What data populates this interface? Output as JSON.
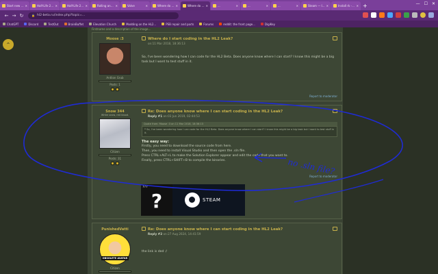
{
  "browser": {
    "tabs": [
      {
        "label": "Start new topic"
      },
      {
        "label": "Half-Life 2 Beta..."
      },
      {
        "label": "Half-Life 2 Beta..."
      },
      {
        "label": "Rolling animation"
      },
      {
        "label": "Valve"
      },
      {
        "label": "Where do I start co..."
      },
      {
        "label": "Where do I start codi...",
        "active": true
      },
      {
        "label": "..."
      },
      {
        "label": "..."
      },
      {
        "label": "..."
      },
      {
        "label": "Steam — Install"
      },
      {
        "label": "Install rk - Beyond Reh..."
      }
    ],
    "address": "hl2-beta.ru/index.php?topic=...",
    "bookmarks": [
      "ChatGPT",
      "Discord",
      "TestOut",
      "BrainBuffet",
      "Elevation Church",
      "Modding on the HL2...",
      "PSB repair and parts",
      "Forums",
      "reddit: the front page...",
      "DigiKey"
    ]
  },
  "page": {
    "top_strip": "Firstname and a description of the image...",
    "report_label": "Report to moderator"
  },
  "posts": [
    {
      "author": "Moose :3",
      "rank": "Antlion Grub",
      "posts_label": "Posts: 1",
      "title": "Where do I start coding in the HL2 Leak?",
      "meta_prefix": "on:",
      "meta_date": "11 Mar 2018, 18:36:13",
      "text": "So, I've been wondering how I can code for the HL2 Beta. Does anyone know where I can start? I know this might be a big task but I want to test stuff in it."
    },
    {
      "author": "Snow 344",
      "tagline": "White snow, red blood.",
      "rank": "Citizen",
      "posts_label": "Posts: 31",
      "title": "Re: Does anyone know where I can start coding in the HL2 Leak?",
      "meta_reply": "Reply #1",
      "meta_prefix": "on:",
      "meta_date": "03 Jun 2019, 02:44:53",
      "quote_head": "Quote from: Moose :3 on 11 Mar 2018, 18:36:13",
      "quote_text": "So, I've been wondering how I can code for the HL2 Beta. Does anyone know where I can start? I know this might be a big task but I want to test stuff in it.",
      "easy_way": "The easy way:",
      "lines": [
        "Firstly, you need to download the source code from here.",
        "Then, you need to install Visual Studio and then open the .sln file.",
        "Press CTRL+ALT+L to make the Solution Explorer appear and edit the code that you want to.",
        "Finally, press CTRL+SHIFT+B to compile the binaries."
      ],
      "signature": {
        "q_label": "???",
        "q_big": "?",
        "steam_label": "STEAM"
      }
    },
    {
      "author": "PunishedVatti",
      "rank": "Citizen",
      "avatar_caption": "OBSOLETE AVATAR",
      "title": "Re: Does anyone know where I can start coding in the HL2 Leak?",
      "meta_reply": "Reply #2",
      "meta_prefix": "on:",
      "meta_date": "27 Aug 2024, 14:41:59",
      "text": "the link is ded :/"
    }
  ],
  "annotation": {
    "text": "no .sln file?"
  },
  "colors": {
    "accent": "#c9b24b",
    "link": "#7fb1d6",
    "ink": "#1f2bd6"
  }
}
